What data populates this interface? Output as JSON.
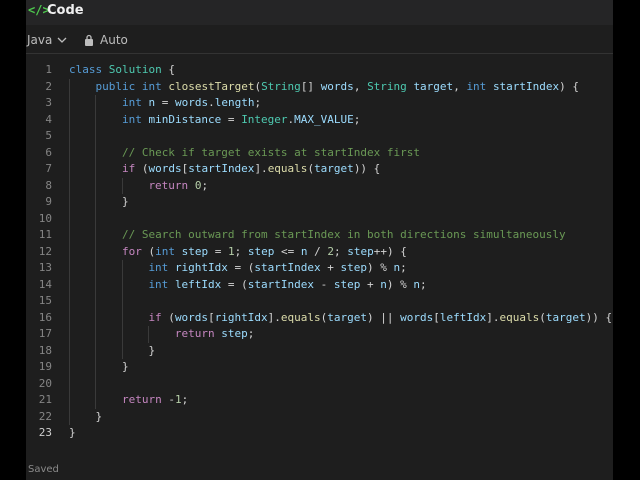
{
  "header": {
    "icon": "code-brackets-icon",
    "title": "Code"
  },
  "toolbar": {
    "language": "Java",
    "mode": "Auto"
  },
  "editor": {
    "lines": [
      {
        "n": "1",
        "indent": 0,
        "tokens": [
          [
            "kw",
            "class"
          ],
          [
            "",
            " "
          ],
          [
            "typ",
            "Solution"
          ],
          [
            "",
            " {"
          ]
        ]
      },
      {
        "n": "2",
        "indent": 1,
        "tokens": [
          [
            "kw",
            "public"
          ],
          [
            "",
            " "
          ],
          [
            "kw",
            "int"
          ],
          [
            "",
            " "
          ],
          [
            "fn",
            "closestTarget"
          ],
          [
            "",
            "("
          ],
          [
            "typ",
            "String"
          ],
          [
            "",
            "[] "
          ],
          [
            "var",
            "words"
          ],
          [
            "",
            ", "
          ],
          [
            "typ",
            "String"
          ],
          [
            "",
            " "
          ],
          [
            "var",
            "target"
          ],
          [
            "",
            ", "
          ],
          [
            "kw",
            "int"
          ],
          [
            "",
            " "
          ],
          [
            "var",
            "startIndex"
          ],
          [
            "",
            ") {"
          ]
        ]
      },
      {
        "n": "3",
        "indent": 2,
        "tokens": [
          [
            "kw",
            "int"
          ],
          [
            "",
            " "
          ],
          [
            "var",
            "n"
          ],
          [
            "",
            " = "
          ],
          [
            "var",
            "words"
          ],
          [
            "",
            "."
          ],
          [
            "var",
            "length"
          ],
          [
            "",
            ";"
          ]
        ]
      },
      {
        "n": "4",
        "indent": 2,
        "tokens": [
          [
            "kw",
            "int"
          ],
          [
            "",
            " "
          ],
          [
            "var",
            "minDistance"
          ],
          [
            "",
            " = "
          ],
          [
            "typ",
            "Integer"
          ],
          [
            "",
            "."
          ],
          [
            "var",
            "MAX_VALUE"
          ],
          [
            "",
            ";"
          ]
        ]
      },
      {
        "n": "5",
        "indent": 2,
        "tokens": []
      },
      {
        "n": "6",
        "indent": 2,
        "tokens": [
          [
            "cmt",
            "// Check if target exists at startIndex first"
          ]
        ]
      },
      {
        "n": "7",
        "indent": 2,
        "tokens": [
          [
            "ctl",
            "if"
          ],
          [
            "",
            " ("
          ],
          [
            "var",
            "words"
          ],
          [
            "",
            "["
          ],
          [
            "var",
            "startIndex"
          ],
          [
            "",
            "]."
          ],
          [
            "fn",
            "equals"
          ],
          [
            "",
            "("
          ],
          [
            "var",
            "target"
          ],
          [
            "",
            ")) {"
          ]
        ]
      },
      {
        "n": "8",
        "indent": 3,
        "tokens": [
          [
            "ctl",
            "return"
          ],
          [
            "",
            " "
          ],
          [
            "num",
            "0"
          ],
          [
            "",
            ";"
          ]
        ]
      },
      {
        "n": "9",
        "indent": 2,
        "tokens": [
          [
            "",
            "}"
          ]
        ]
      },
      {
        "n": "10",
        "indent": 2,
        "tokens": []
      },
      {
        "n": "11",
        "indent": 2,
        "tokens": [
          [
            "cmt",
            "// Search outward from startIndex in both directions simultaneously"
          ]
        ]
      },
      {
        "n": "12",
        "indent": 2,
        "tokens": [
          [
            "ctl",
            "for"
          ],
          [
            "",
            " ("
          ],
          [
            "kw",
            "int"
          ],
          [
            "",
            " "
          ],
          [
            "var",
            "step"
          ],
          [
            "",
            " = "
          ],
          [
            "num",
            "1"
          ],
          [
            "",
            "; "
          ],
          [
            "var",
            "step"
          ],
          [
            "",
            " <= "
          ],
          [
            "var",
            "n"
          ],
          [
            "",
            " / "
          ],
          [
            "num",
            "2"
          ],
          [
            "",
            "; "
          ],
          [
            "var",
            "step"
          ],
          [
            "",
            "++) {"
          ]
        ]
      },
      {
        "n": "13",
        "indent": 3,
        "tokens": [
          [
            "kw",
            "int"
          ],
          [
            "",
            " "
          ],
          [
            "var",
            "rightIdx"
          ],
          [
            "",
            " = ("
          ],
          [
            "var",
            "startIndex"
          ],
          [
            "",
            " + "
          ],
          [
            "var",
            "step"
          ],
          [
            "",
            ") % "
          ],
          [
            "var",
            "n"
          ],
          [
            "",
            ";"
          ]
        ]
      },
      {
        "n": "14",
        "indent": 3,
        "tokens": [
          [
            "kw",
            "int"
          ],
          [
            "",
            " "
          ],
          [
            "var",
            "leftIdx"
          ],
          [
            "",
            " = ("
          ],
          [
            "var",
            "startIndex"
          ],
          [
            "",
            " - "
          ],
          [
            "var",
            "step"
          ],
          [
            "",
            " + "
          ],
          [
            "var",
            "n"
          ],
          [
            "",
            ") % "
          ],
          [
            "var",
            "n"
          ],
          [
            "",
            ";"
          ]
        ]
      },
      {
        "n": "15",
        "indent": 3,
        "tokens": []
      },
      {
        "n": "16",
        "indent": 3,
        "tokens": [
          [
            "ctl",
            "if"
          ],
          [
            "",
            " ("
          ],
          [
            "var",
            "words"
          ],
          [
            "",
            "["
          ],
          [
            "var",
            "rightIdx"
          ],
          [
            "",
            "]."
          ],
          [
            "fn",
            "equals"
          ],
          [
            "",
            "("
          ],
          [
            "var",
            "target"
          ],
          [
            "",
            ") || "
          ],
          [
            "var",
            "words"
          ],
          [
            "",
            "["
          ],
          [
            "var",
            "leftIdx"
          ],
          [
            "",
            "]."
          ],
          [
            "fn",
            "equals"
          ],
          [
            "",
            "("
          ],
          [
            "var",
            "target"
          ],
          [
            "",
            ")) {"
          ]
        ]
      },
      {
        "n": "17",
        "indent": 4,
        "tokens": [
          [
            "ctl",
            "return"
          ],
          [
            "",
            " "
          ],
          [
            "var",
            "step"
          ],
          [
            "",
            ";"
          ]
        ]
      },
      {
        "n": "18",
        "indent": 3,
        "tokens": [
          [
            "",
            "}"
          ]
        ]
      },
      {
        "n": "19",
        "indent": 2,
        "tokens": [
          [
            "",
            "}"
          ]
        ]
      },
      {
        "n": "20",
        "indent": 2,
        "tokens": []
      },
      {
        "n": "21",
        "indent": 2,
        "tokens": [
          [
            "ctl",
            "return"
          ],
          [
            "",
            " -"
          ],
          [
            "num",
            "1"
          ],
          [
            "",
            ";"
          ]
        ]
      },
      {
        "n": "22",
        "indent": 1,
        "tokens": [
          [
            "",
            "}"
          ]
        ]
      },
      {
        "n": "23",
        "indent": 0,
        "tokens": [
          [
            "",
            "}"
          ]
        ]
      }
    ],
    "active_line": "23"
  },
  "status": {
    "text": "Saved"
  }
}
